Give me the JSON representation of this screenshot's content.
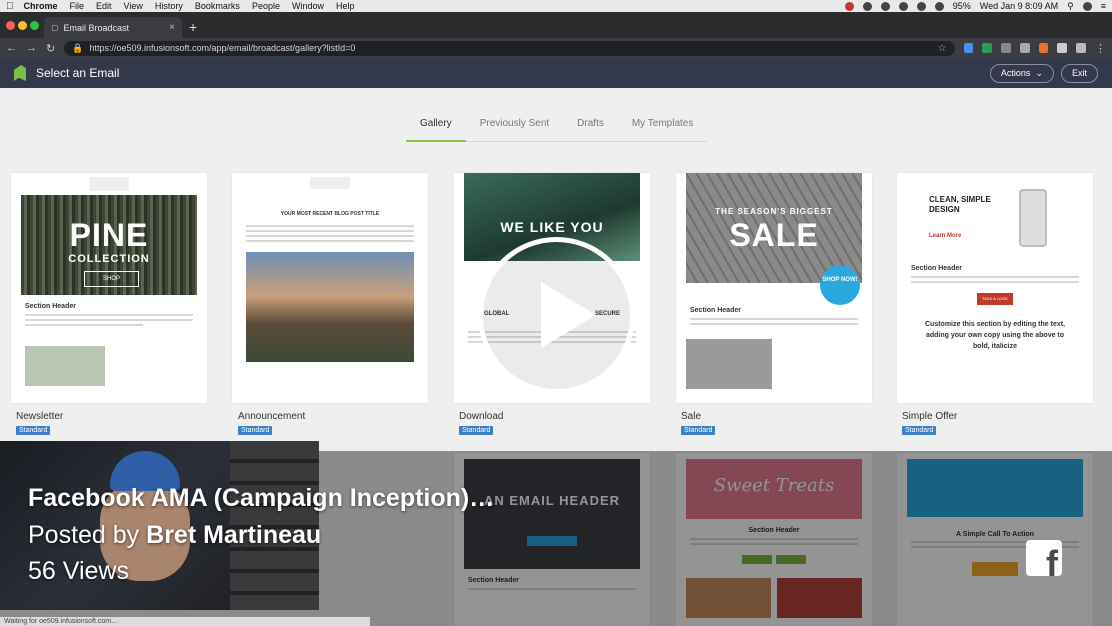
{
  "menubar": {
    "app": "Chrome",
    "items": [
      "File",
      "Edit",
      "View",
      "History",
      "Bookmarks",
      "People",
      "Window",
      "Help"
    ],
    "battery": "95%",
    "datetime": "Wed Jan 9  8:09 AM"
  },
  "browser": {
    "tab_title": "Email Broadcast",
    "url": "https://oe509.infusionsoft.com/app/email/broadcast/gallery?listId=0",
    "status_text": "Waiting for oe509.infusionsoft.com..."
  },
  "app": {
    "title": "Select an Email",
    "actions_label": "Actions",
    "exit_label": "Exit"
  },
  "tabs": [
    "Gallery",
    "Previously Sent",
    "Drafts",
    "My Templates"
  ],
  "templates": [
    {
      "name": "Newsletter",
      "badge": "Standard",
      "hero": "PINE",
      "hero_sub": "COLLECTION",
      "button": "SHOP",
      "section": "Section Header"
    },
    {
      "name": "Announcement",
      "badge": "Standard",
      "hero": "YOUR MOST RECENT BLOG POST TITLE"
    },
    {
      "name": "Download",
      "badge": "Standard",
      "hero": "WE LIKE YOU",
      "labels": [
        "GLOBAL",
        "SECURE"
      ]
    },
    {
      "name": "Sale",
      "badge": "Standard",
      "hero_sub": "THE SEASON'S BIGGEST",
      "hero": "SALE",
      "circle": "SHOP NOW!",
      "section": "Section Header"
    },
    {
      "name": "Simple Offer",
      "badge": "Standard",
      "hero": "CLEAN, SIMPLE DESIGN",
      "link": "Learn More",
      "section": "Section Header",
      "button": "TAKE A LOOK",
      "body": "Customize this section by editing the text, adding your own copy using the above to bold, italicize"
    }
  ],
  "row2": [
    {
      "hero": "AN EMAIL HEADER",
      "section": "Section Header"
    },
    {
      "hero": "Sweet Treats",
      "section": "Section Header"
    },
    {
      "hero": "A Simple Call To Action"
    }
  ],
  "video": {
    "title": "Facebook AMA (Campaign Inception)…",
    "posted_prefix": "Posted by",
    "author": "Bret Martineau",
    "views": "56 Views"
  },
  "colors": {
    "app_header": "#33394a",
    "accent": "#8bc34a",
    "badge": "#3d7fc4"
  }
}
